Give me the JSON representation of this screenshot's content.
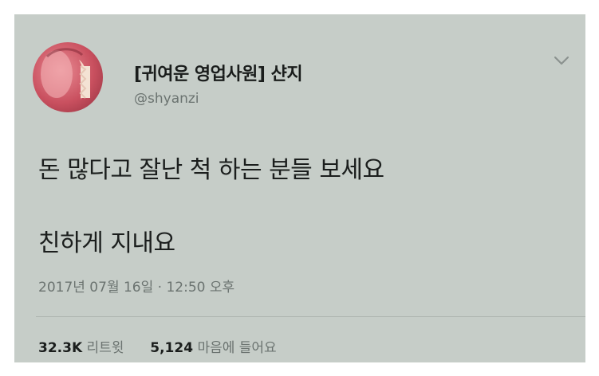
{
  "tweet": {
    "display_name": "[귀여운 영업사원] 샨지",
    "handle": "@shyanzi",
    "text_line1": "돈 많다고 잘난 척 하는 분들 보세요",
    "text_line2": "친하게 지내요",
    "timestamp": "2017년 07월 16일 · 12:50 오후",
    "retweets_count": "32.3K",
    "retweets_label": "리트윗",
    "likes_count": "5,124",
    "likes_label": "마음에 들어요",
    "menu_icon": "chevron-down-icon",
    "avatar_icon": "peach-avatar"
  },
  "colors": {
    "card_background": "#c6cdc8",
    "text_primary": "#1a1d1c",
    "text_secondary": "#6b7370"
  }
}
